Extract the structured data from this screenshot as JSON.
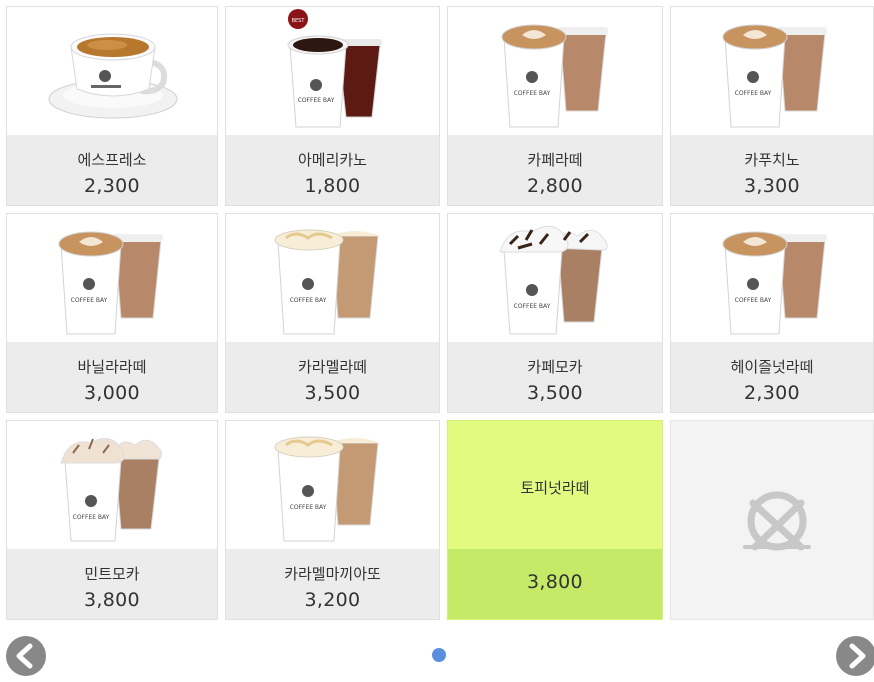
{
  "menu": {
    "items": [
      {
        "name": "에스프레소",
        "price": "2,300",
        "icon": "espresso-cup-icon"
      },
      {
        "name": "아메리카노",
        "price": "1,800",
        "icon": "americano-cups-icon"
      },
      {
        "name": "카페라떼",
        "price": "2,800",
        "icon": "latte-cups-icon"
      },
      {
        "name": "카푸치노",
        "price": "3,300",
        "icon": "cappuccino-cups-icon"
      },
      {
        "name": "바닐라라떼",
        "price": "3,000",
        "icon": "vanilla-latte-cups-icon"
      },
      {
        "name": "카라멜라떼",
        "price": "3,500",
        "icon": "caramel-latte-cups-icon"
      },
      {
        "name": "카페모카",
        "price": "3,500",
        "icon": "cafe-mocha-cups-icon"
      },
      {
        "name": "헤이즐넛라떼",
        "price": "2,300",
        "icon": "hazelnut-latte-cups-icon"
      },
      {
        "name": "민트모카",
        "price": "3,800",
        "icon": "mint-mocha-cups-icon"
      },
      {
        "name": "카라멜마끼아또",
        "price": "3,200",
        "icon": "caramel-macchiato-cups-icon"
      },
      {
        "name": "토피넛라떼",
        "price": "3,800",
        "selected": true
      },
      {
        "empty": true,
        "icon": "plate-fork-knife-icon"
      }
    ]
  },
  "cup_brand": "COFFEE BAY",
  "badge_text": "BEST",
  "pagination": {
    "current_page": 1,
    "total_pages": 1
  },
  "colors": {
    "selected_tile": "#e2fa80",
    "selected_price_bar": "#c5ea67",
    "info_bar": "#ececec",
    "pager_dot": "#5b8fde",
    "arrow": "#888888"
  }
}
